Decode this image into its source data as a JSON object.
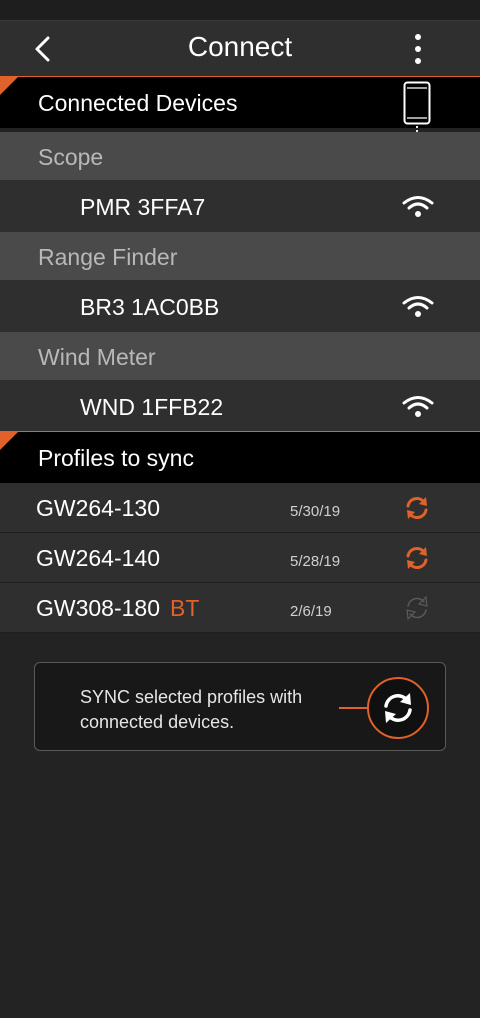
{
  "header": {
    "title": "Connect",
    "back_icon": "chevron-left-icon",
    "menu_icon": "more-vertical-icon"
  },
  "connected_devices": {
    "heading": "Connected Devices",
    "icon": "phone-icon",
    "groups": [
      {
        "category": "Scope",
        "device": "PMR 3FFA7",
        "icon": "wifi-icon"
      },
      {
        "category": "Range Finder",
        "device": "BR3 1AC0BB",
        "icon": "wifi-icon"
      },
      {
        "category": "Wind Meter",
        "device": "WND 1FFB22",
        "icon": "wifi-icon"
      }
    ]
  },
  "profiles": {
    "heading": "Profiles to sync",
    "items": [
      {
        "name": "GW264-130",
        "tag": "",
        "date": "5/30/19",
        "sync_enabled": true
      },
      {
        "name": "GW264-140",
        "tag": "",
        "date": "5/28/19",
        "sync_enabled": true
      },
      {
        "name": "GW308-180",
        "tag": "BT",
        "date": "2/6/19",
        "sync_enabled": false
      }
    ]
  },
  "sync_panel": {
    "text": "SYNC selected profiles with connected devices.",
    "icon": "sync-icon"
  },
  "colors": {
    "accent": "#e0612a",
    "background": "#232323",
    "row": "#2f2f2f",
    "category_row": "#4a4a4a",
    "disabled_icon": "#5a5a5a"
  }
}
